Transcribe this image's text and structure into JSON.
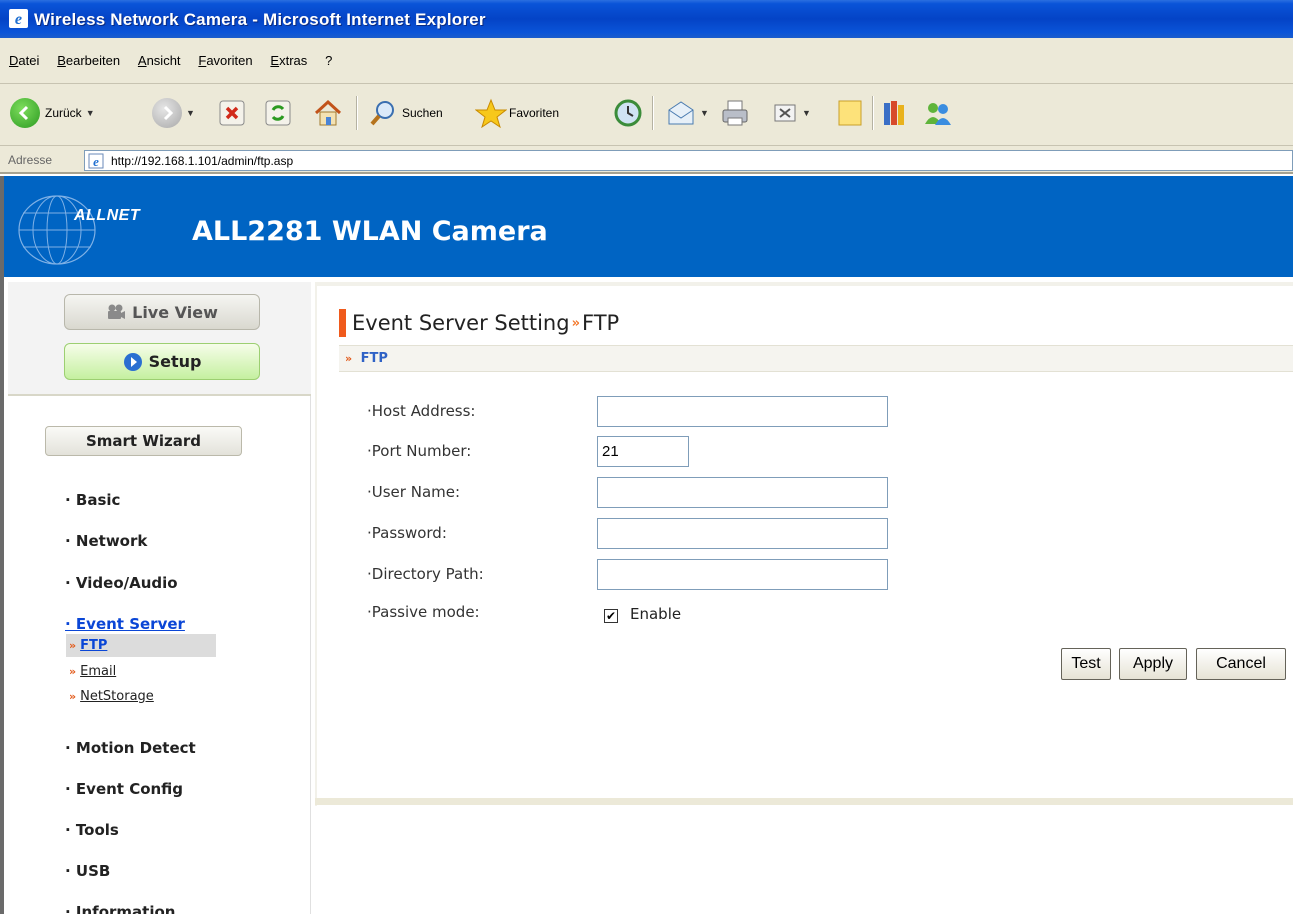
{
  "window": {
    "title": "Wireless Network Camera - Microsoft Internet Explorer"
  },
  "menubar": {
    "items": [
      "Datei",
      "Bearbeiten",
      "Ansicht",
      "Favoriten",
      "Extras",
      "?"
    ]
  },
  "toolbar": {
    "back_label": "Zurück",
    "search_label": "Suchen",
    "favorites_label": "Favoriten"
  },
  "address": {
    "label": "Adresse",
    "url": "http://192.168.1.101/admin/ftp.asp"
  },
  "banner": {
    "brand": "ALLNET",
    "heading": "ALL2281 WLAN Camera"
  },
  "sidebar": {
    "live_view": "Live View",
    "setup": "Setup",
    "smart_wizard": "Smart Wizard",
    "items": [
      {
        "label": "· Basic"
      },
      {
        "label": "· Network"
      },
      {
        "label": "· Video/Audio"
      },
      {
        "label": "· Event Server"
      },
      {
        "label": "· Motion Detect"
      },
      {
        "label": "· Event Config"
      },
      {
        "label": "· Tools"
      },
      {
        "label": "· USB"
      },
      {
        "label": "· Information"
      }
    ],
    "subitems": [
      {
        "label": "FTP"
      },
      {
        "label": "Email"
      },
      {
        "label": "NetStorage"
      }
    ]
  },
  "content": {
    "title_main": "Event Server Setting",
    "title_sub": "FTP",
    "section": "FTP",
    "fields": {
      "host": {
        "label": "·Host Address:",
        "value": ""
      },
      "port": {
        "label": "·Port Number:",
        "value": "21"
      },
      "user": {
        "label": "·User Name:",
        "value": ""
      },
      "password": {
        "label": "·Password:",
        "value": ""
      },
      "directory": {
        "label": "·Directory Path:",
        "value": ""
      },
      "passive": {
        "label": "·Passive mode:",
        "option": "Enable",
        "checked": true
      }
    },
    "buttons": {
      "test": "Test",
      "apply": "Apply",
      "cancel": "Cancel"
    }
  },
  "colors": {
    "banner": "#0064c3",
    "accent": "#f05a1c",
    "link_active": "#0a46d6",
    "title_bar": "#0443c6"
  }
}
